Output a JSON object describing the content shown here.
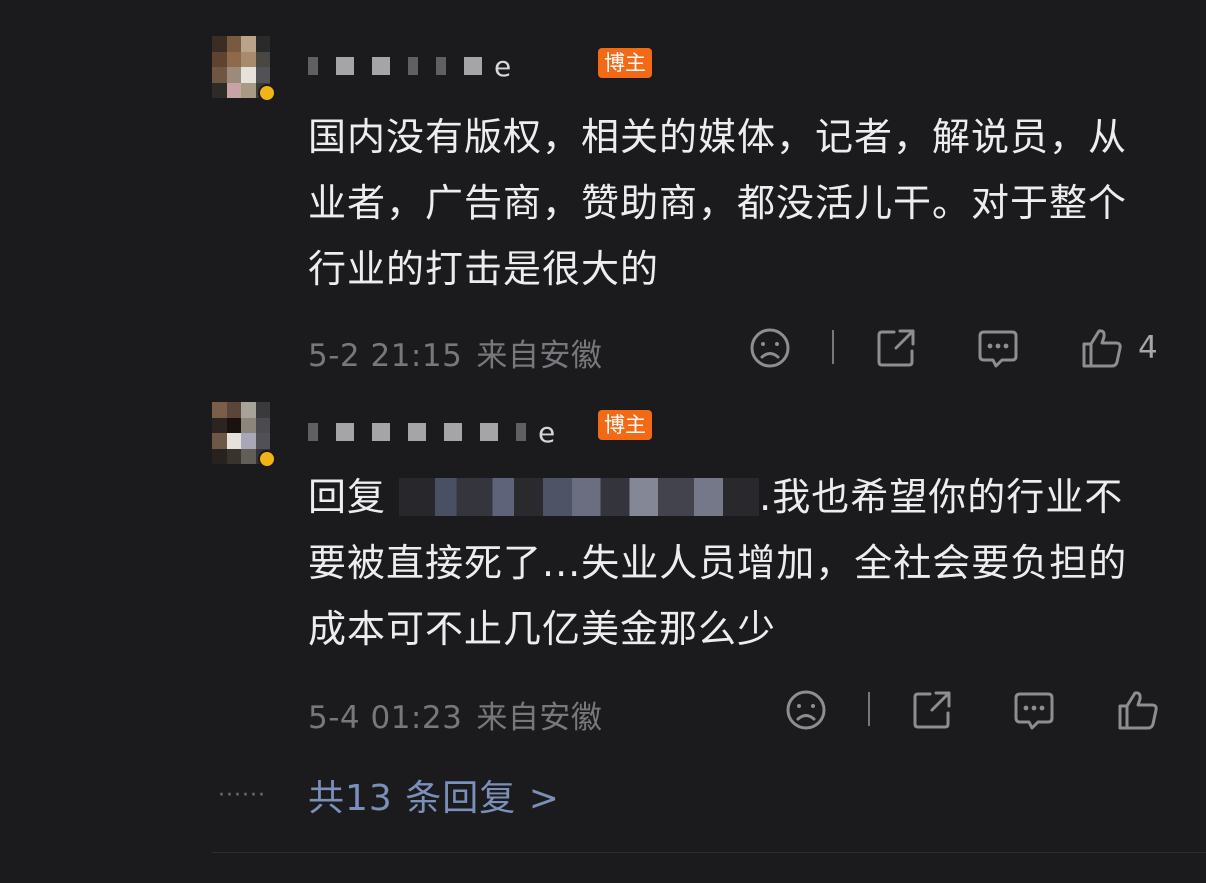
{
  "comments": [
    {
      "username_tail": "e",
      "badge": "博主",
      "text": "国内没有版权，相关的媒体，记者，解说员，从业者，广告商，赞助商，都没活儿干。对于整个行业的打击是很大的",
      "date": "5-2 21:15",
      "location": "来自安徽",
      "likes": "4"
    },
    {
      "username_tail": "e",
      "badge": "博主",
      "reply_prefix": "回复",
      "text_after_mention": ".我也希望你的行业不要被直接死了...失业人员增加，全社会要负担的成本可不止几亿美金那么少",
      "date": "5-4 01:23",
      "location": "来自安徽",
      "likes": ""
    }
  ],
  "more_replies": {
    "dots": "······",
    "label": "共13 条回复 >"
  },
  "icons": [
    "dislike-icon",
    "share-icon",
    "comment-icon",
    "like-icon"
  ],
  "colors": {
    "background": "#1b1b1d",
    "badge": "#f36a16",
    "link": "#7b8fb8",
    "meta": "#77777c"
  }
}
